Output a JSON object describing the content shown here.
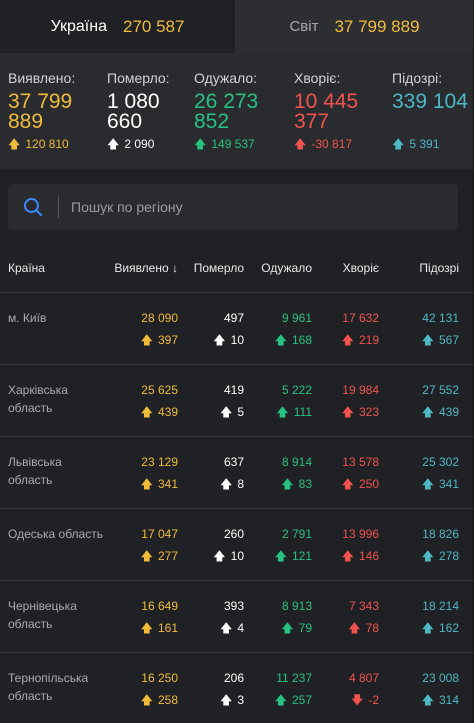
{
  "tabs": [
    {
      "name": "Україна",
      "value": "270 587"
    },
    {
      "name": "Світ",
      "value": "37 799 889"
    }
  ],
  "summary": [
    {
      "label": "Виявлено:",
      "value": "37 799 889",
      "delta": "120 810",
      "dir": "up",
      "color": "#f0bc39"
    },
    {
      "label": "Померло:",
      "value": "1 080 660",
      "delta": "2 090",
      "dir": "up",
      "color": "#ffffff"
    },
    {
      "label": "Одужало:",
      "value": "26 273 852",
      "delta": "149 537",
      "dir": "up",
      "color": "#26c281"
    },
    {
      "label": "Хворіє:",
      "value": "10 445 377",
      "delta": "-30 817",
      "dir": "up",
      "color": "#f0524f"
    },
    {
      "label": "Підозрі:",
      "value": "339 104",
      "delta": "5 391",
      "dir": "up",
      "color": "#4bb8c4"
    }
  ],
  "search": {
    "placeholder": "Пошук по регіону"
  },
  "table": {
    "headers": [
      "Країна",
      "Виявлено ↓",
      "Померло",
      "Одужало",
      "Хворіє",
      "Підозрі"
    ],
    "rows": [
      {
        "name": "м. Київ",
        "confirmed": "28 090",
        "confirmed_d": "397",
        "deaths": "497",
        "deaths_d": "10",
        "recovered": "9 961",
        "recovered_d": "168",
        "sick": "17 632",
        "sick_d": "219",
        "sick_dir": "up",
        "susp": "42 131",
        "susp_d": "567"
      },
      {
        "name": "Харківська область",
        "confirmed": "25 625",
        "confirmed_d": "439",
        "deaths": "419",
        "deaths_d": "5",
        "recovered": "5 222",
        "recovered_d": "111",
        "sick": "19 984",
        "sick_d": "323",
        "sick_dir": "up",
        "susp": "27 552",
        "susp_d": "439"
      },
      {
        "name": "Львівська область",
        "confirmed": "23 129",
        "confirmed_d": "341",
        "deaths": "637",
        "deaths_d": "8",
        "recovered": "8 914",
        "recovered_d": "83",
        "sick": "13 578",
        "sick_d": "250",
        "sick_dir": "up",
        "susp": "25 302",
        "susp_d": "341"
      },
      {
        "name": "Одеська область",
        "confirmed": "17 047",
        "confirmed_d": "277",
        "deaths": "260",
        "deaths_d": "10",
        "recovered": "2 791",
        "recovered_d": "121",
        "sick": "13 996",
        "sick_d": "146",
        "sick_dir": "up",
        "susp": "18 826",
        "susp_d": "278"
      },
      {
        "name": "Чернівецька область",
        "confirmed": "16 649",
        "confirmed_d": "161",
        "deaths": "393",
        "deaths_d": "4",
        "recovered": "8 913",
        "recovered_d": "79",
        "sick": "7 343",
        "sick_d": "78",
        "sick_dir": "up",
        "susp": "18 214",
        "susp_d": "162"
      },
      {
        "name": "Тернопільська область",
        "confirmed": "16 250",
        "confirmed_d": "258",
        "deaths": "206",
        "deaths_d": "3",
        "recovered": "11 237",
        "recovered_d": "257",
        "sick": "4 807",
        "sick_d": "-2",
        "sick_dir": "down",
        "susp": "23 008",
        "susp_d": "314"
      }
    ]
  },
  "colors": {
    "confirmed": "#f0bc39",
    "deaths": "#ffffff",
    "recovered": "#26c281",
    "sick": "#f0524f",
    "suspected": "#4bb8c4"
  }
}
